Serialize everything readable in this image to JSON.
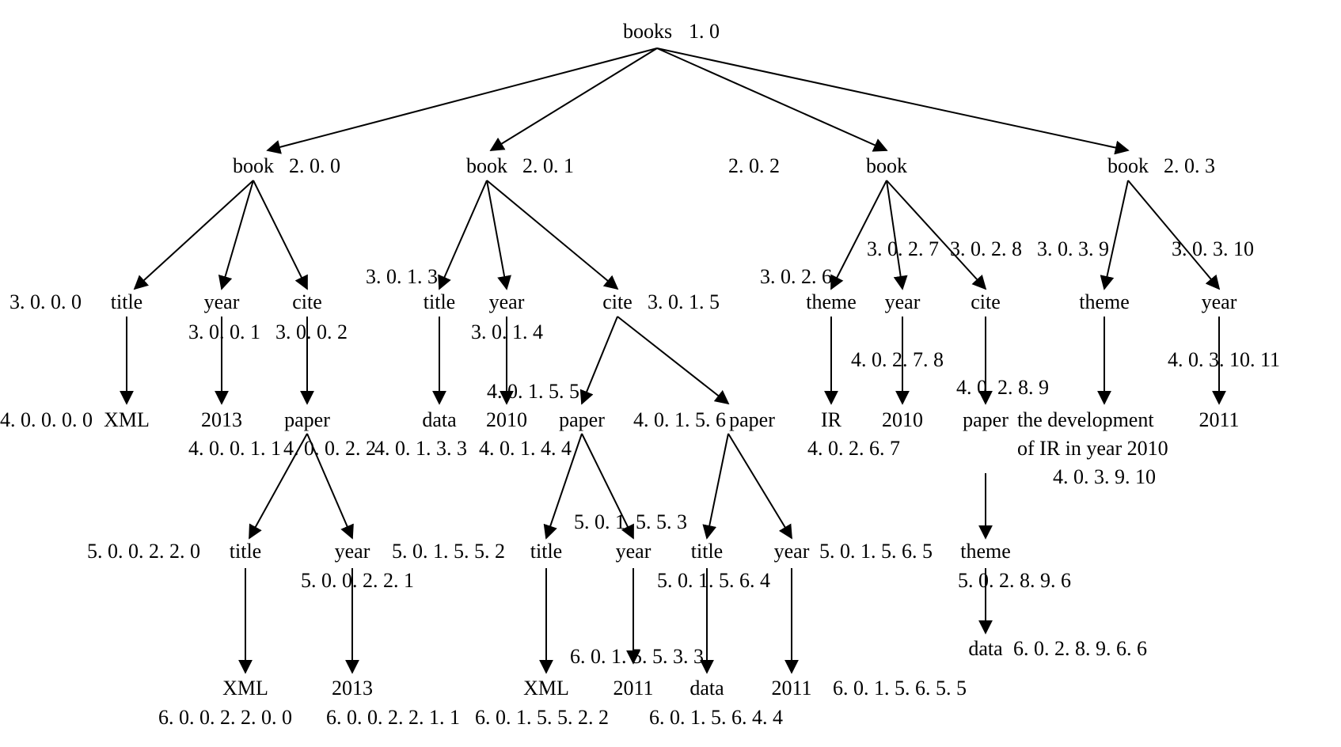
{
  "tree": {
    "root": {
      "label": "books",
      "code": "1. 0"
    },
    "book0": {
      "label": "book",
      "code": "2. 0. 0",
      "title": {
        "label": "title",
        "code": "3. 0. 0. 0",
        "leaf": {
          "label": "XML",
          "code": "4. 0. 0. 0. 0"
        }
      },
      "year": {
        "label": "year",
        "code": "3. 0. 0. 1",
        "leaf": {
          "label": "2013",
          "code": "4. 0. 0. 1. 1"
        }
      },
      "cite": {
        "label": "cite",
        "code": "3. 0. 0. 2",
        "paper": {
          "label": "paper",
          "code": "4. 0. 0. 2. 2",
          "title": {
            "label": "title",
            "code": "5. 0. 0. 2. 2. 0",
            "leaf": {
              "label": "XML",
              "code": "6. 0. 0. 2. 2. 0. 0"
            }
          },
          "year": {
            "label": "year",
            "code": "5. 0. 0. 2. 2. 1",
            "leaf": {
              "label": "2013",
              "code": "6. 0. 0. 2. 2. 1. 1"
            }
          }
        }
      }
    },
    "book1": {
      "label": "book",
      "code": "2. 0. 1",
      "title": {
        "label": "title",
        "code": "3. 0. 1. 3",
        "leaf": {
          "label": "data",
          "code": "4. 0. 1. 3. 3"
        }
      },
      "year": {
        "label": "year",
        "code": "3. 0. 1. 4",
        "leaf": {
          "label": "2010",
          "code": "4. 0. 1. 4. 4"
        }
      },
      "cite": {
        "label": "cite",
        "code": "3. 0. 1. 5",
        "paper1": {
          "label": "paper",
          "code": "4. 0. 1. 5. 5",
          "title": {
            "label": "title",
            "code": "5. 0. 1. 5. 5. 2",
            "leaf": {
              "label": "XML",
              "code": "6. 0. 1. 5. 5. 2. 2"
            }
          },
          "year": {
            "label": "year",
            "code": "5. 0. 1. 5. 5. 3",
            "leaf": {
              "label": "2011",
              "code": "6. 0. 1. 5. 5. 3. 3"
            }
          }
        },
        "paper2": {
          "label": "paper",
          "code": "4. 0. 1. 5. 6",
          "title": {
            "label": "title",
            "code": "5. 0. 1. 5. 6. 4",
            "leaf": {
              "label": "data",
              "code": "6. 0. 1. 5. 6. 4. 4"
            }
          },
          "year": {
            "label": "year",
            "code": "5. 0. 1. 5. 6. 5",
            "leaf": {
              "label": "2011",
              "code": "6. 0. 1. 5. 6. 5. 5"
            }
          }
        }
      }
    },
    "book2": {
      "label": "book",
      "code": "2. 0. 2",
      "theme": {
        "label": "theme",
        "code": "3. 0. 2. 6",
        "leaf": {
          "label": "IR",
          "code": "4. 0. 2. 6. 7"
        }
      },
      "year": {
        "label": "year",
        "code": "3. 0. 2. 7",
        "leaf": {
          "label": "2010",
          "code": "4. 0. 2. 7. 8"
        }
      },
      "cite": {
        "label": "cite",
        "code": "3. 0. 2. 8",
        "paper": {
          "label": "paper",
          "code": "4. 0. 2. 8. 9",
          "theme": {
            "label": "theme",
            "code": "5. 0. 2. 8. 9. 6",
            "leaf": {
              "label": "data",
              "code": "6. 0. 2. 8. 9. 6. 6"
            }
          }
        }
      }
    },
    "book3": {
      "label": "book",
      "code": "2. 0. 3",
      "theme": {
        "label": "theme",
        "code": "3. 0. 3. 9",
        "leaf_line1": "the development",
        "leaf_line2": "of IR in year 2010",
        "leaf_code": "4. 0. 3. 9. 10"
      },
      "year": {
        "label": "year",
        "code": "3. 0. 3. 10",
        "leaf": {
          "label": "2011",
          "code": "4. 0. 3. 10. 11"
        }
      }
    }
  }
}
